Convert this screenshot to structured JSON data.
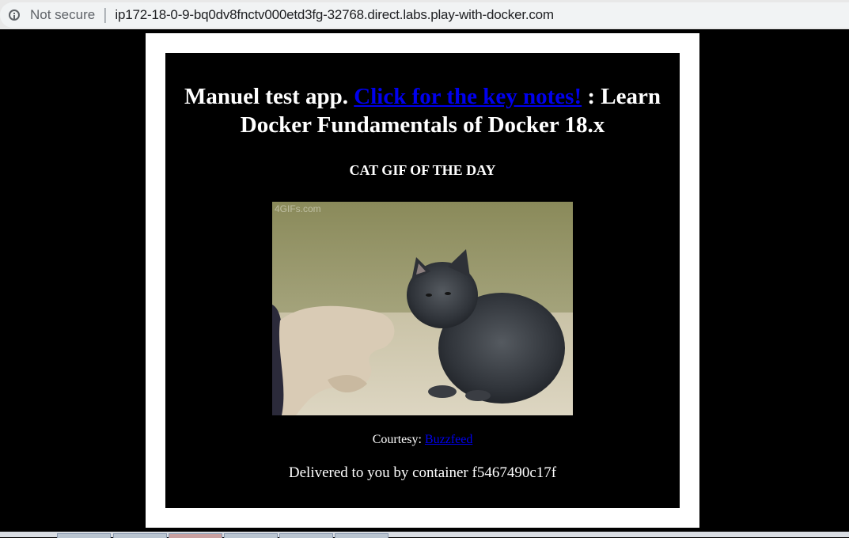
{
  "browser": {
    "security_label": "Not secure",
    "separator": "|",
    "url": "ip172-18-0-9-bq0dv8fnctv000etd3fg-32768.direct.labs.play-with-docker.com"
  },
  "page": {
    "heading_prefix": "Manuel test app.",
    "heading_link": "Click for the key notes!",
    "heading_suffix": ": Learn Docker Fundamentals of Docker 18.x",
    "subheading": "CAT GIF OF THE DAY",
    "gif_watermark": "4GIFs.com",
    "courtesy_label": "Courtesy:",
    "courtesy_link": "Buzzfeed",
    "delivered_text": "Delivered to you by container f5467490c17f"
  },
  "colors": {
    "link": "#0000ee",
    "page_bg": "#000000",
    "frame": "#ffffff"
  }
}
